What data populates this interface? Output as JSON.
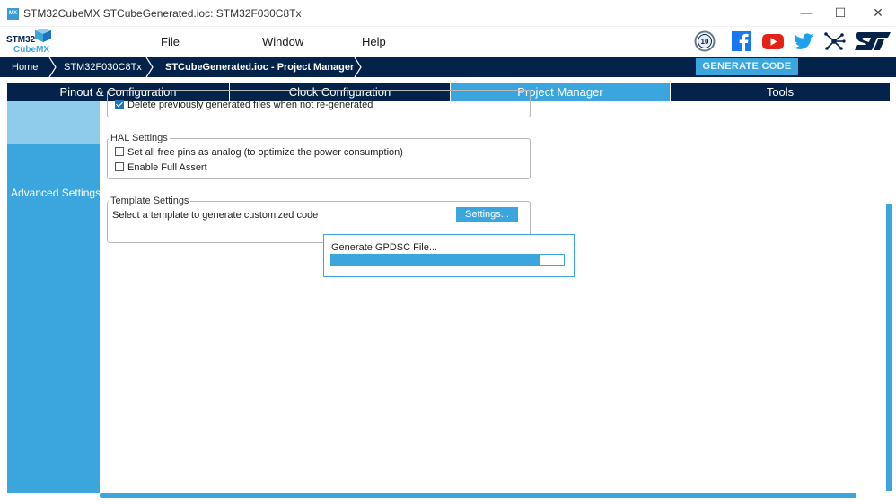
{
  "window": {
    "icon_text": "MX",
    "title": "STM32CubeMX STCubeGenerated.ioc: STM32F030C8Tx",
    "minimize": "—",
    "maximize": "☐",
    "close": "✕"
  },
  "logo": {
    "line1": "STM32",
    "line2": "CubeMX"
  },
  "menu": {
    "file": "File",
    "window": "Window",
    "help": "Help"
  },
  "social": {
    "anniversary_icon": "10-year-badge-icon",
    "facebook_icon": "facebook-icon",
    "youtube_icon": "youtube-icon",
    "twitter_icon": "twitter-icon",
    "network_icon": "network-share-icon",
    "st_logo": "st-logo-icon",
    "anniversary_text": "10"
  },
  "breadcrumb": {
    "home": "Home",
    "device": "STM32F030C8Tx",
    "project": "STCubeGenerated.ioc - Project Manager"
  },
  "generate_code": "GENERATE CODE",
  "tabs": [
    {
      "label": "Pinout & Configuration",
      "active": false
    },
    {
      "label": "Clock Configuration",
      "active": false
    },
    {
      "label": "Project Manager",
      "active": true
    },
    {
      "label": "Tools",
      "active": false
    }
  ],
  "sidebar": {
    "advanced_settings": "Advanced Settings"
  },
  "content": {
    "delete_files": {
      "label": "Delete previously generated files when not re-generated",
      "checked": true
    },
    "hal_settings": {
      "title": "HAL Settings",
      "free_pins": {
        "label": "Set all free pins as analog (to optimize the power consumption)",
        "checked": false
      },
      "full_assert": {
        "label": "Enable Full Assert",
        "checked": false
      }
    },
    "template_settings": {
      "title": "Template Settings",
      "description": "Select a template to generate customized code",
      "button": "Settings..."
    }
  },
  "progress_dialog": {
    "text": "Generate GPDSC File...",
    "progress_fraction": 0.9
  },
  "colors": {
    "navy": "#03234b",
    "accent": "#3aa6dd",
    "light_accent": "#8fcbeb"
  }
}
